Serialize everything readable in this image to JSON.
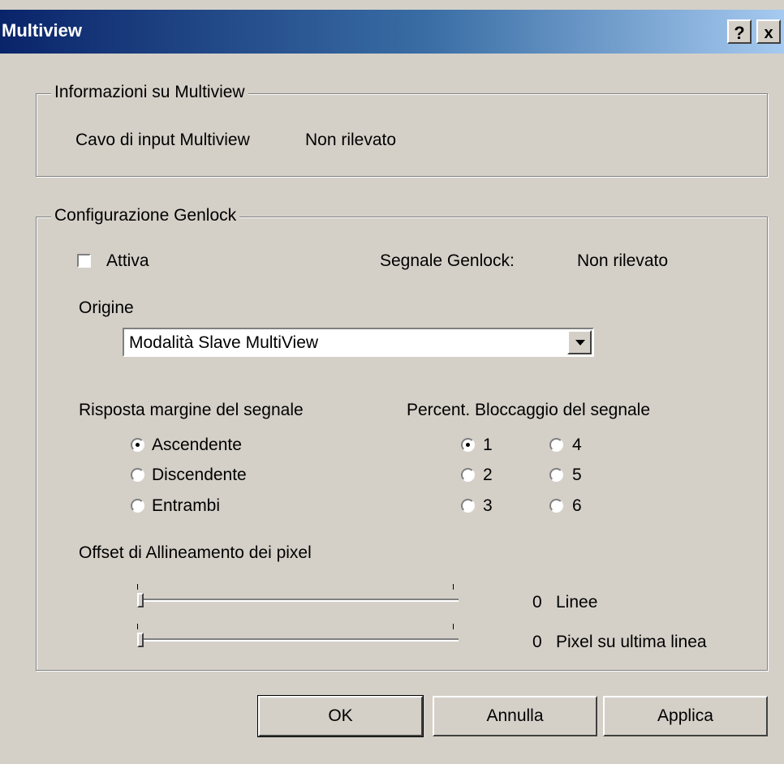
{
  "window": {
    "title": "Multiview",
    "help_label": "?",
    "close_label": "x"
  },
  "info_group": {
    "title": "Informazioni su Multiview",
    "cable_label": "Cavo di input Multiview",
    "cable_status": "Non rilevato"
  },
  "genlock_group": {
    "title": "Configurazione Genlock",
    "enable_label": "Attiva",
    "enable_checked": false,
    "signal_label": "Segnale Genlock:",
    "signal_status": "Non rilevato",
    "origin_label": "Origine",
    "origin_value": "Modalità Slave MultiView",
    "edge_label": "Risposta margine del segnale",
    "edge_options": [
      "Ascendente",
      "Discendente",
      "Entrambi"
    ],
    "edge_selected": "Ascendente",
    "lock_label": "Percent. Bloccaggio del segnale",
    "lock_options": [
      "1",
      "2",
      "3",
      "4",
      "5",
      "6"
    ],
    "lock_selected": "1",
    "offset_label": "Offset di Allineamento dei pixel",
    "lines_value": "0",
    "lines_unit": "Linee",
    "pixels_value": "0",
    "pixels_unit": "Pixel su ultima linea"
  },
  "buttons": {
    "ok": "OK",
    "cancel": "Annulla",
    "apply": "Applica"
  }
}
